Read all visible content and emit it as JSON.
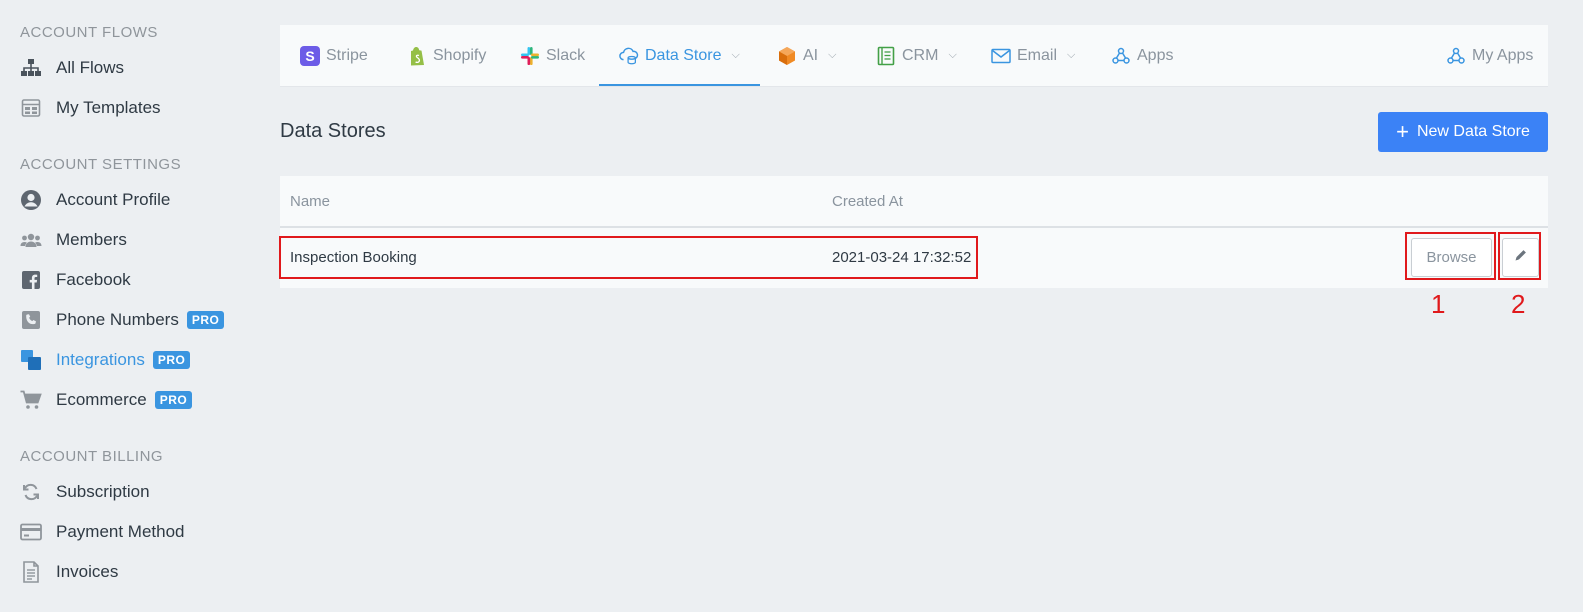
{
  "sidebar": {
    "sections": [
      {
        "title": "ACCOUNT FLOWS"
      },
      {
        "title": "ACCOUNT SETTINGS"
      },
      {
        "title": "ACCOUNT BILLING"
      }
    ],
    "items": [
      {
        "label": "All Flows",
        "icon": "sitemap-icon"
      },
      {
        "label": "My Templates",
        "icon": "template-icon"
      },
      {
        "label": "Account Profile",
        "icon": "user-circle-icon"
      },
      {
        "label": "Members",
        "icon": "users-icon"
      },
      {
        "label": "Facebook",
        "icon": "facebook-icon"
      },
      {
        "label": "Phone Numbers",
        "icon": "phone-icon",
        "badge": "PRO"
      },
      {
        "label": "Integrations",
        "icon": "integrations-icon",
        "badge": "PRO",
        "active": true
      },
      {
        "label": "Ecommerce",
        "icon": "cart-icon",
        "badge": "PRO"
      },
      {
        "label": "Subscription",
        "icon": "sync-icon"
      },
      {
        "label": "Payment Method",
        "icon": "credit-card-icon"
      },
      {
        "label": "Invoices",
        "icon": "invoice-icon"
      }
    ]
  },
  "topnav": {
    "tabs": [
      {
        "label": "Stripe",
        "icon": "stripe-icon"
      },
      {
        "label": "Shopify",
        "icon": "shopify-icon"
      },
      {
        "label": "Slack",
        "icon": "slack-icon"
      },
      {
        "label": "Data Store",
        "icon": "cloud-database-icon",
        "dropdown": true,
        "active": true
      },
      {
        "label": "AI",
        "icon": "cube-icon",
        "dropdown": true
      },
      {
        "label": "CRM",
        "icon": "crm-icon",
        "dropdown": true
      },
      {
        "label": "Email",
        "icon": "envelope-icon",
        "dropdown": true
      },
      {
        "label": "Apps",
        "icon": "webhook-icon"
      },
      {
        "label": "My Apps",
        "icon": "webhook-icon"
      }
    ]
  },
  "main": {
    "title": "Data Stores",
    "new_button_label": "New Data Store",
    "table": {
      "columns": [
        "Name",
        "Created At"
      ],
      "rows": [
        {
          "name": "Inspection Booking",
          "created_at": "2021-03-24 17:32:52",
          "browse_label": "Browse"
        }
      ]
    }
  },
  "annotations": {
    "one": "1",
    "two": "2"
  },
  "colors": {
    "accent": "#3a95e0",
    "button": "#3b82f6",
    "annotation": "#e0191c",
    "badge": "#3a95e0"
  }
}
